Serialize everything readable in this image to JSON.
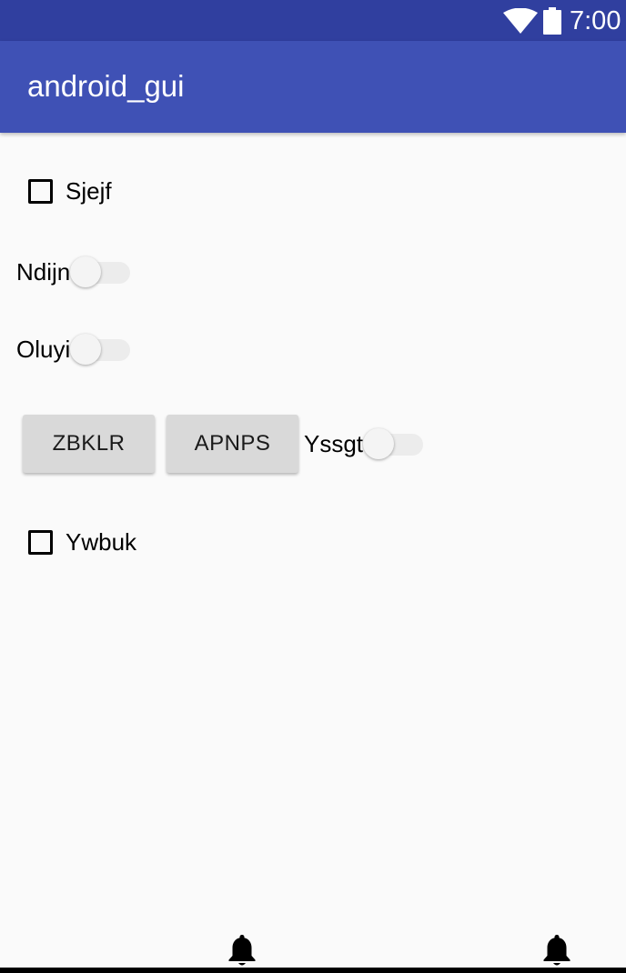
{
  "status_bar": {
    "time": "7:00",
    "icons": [
      "wifi-icon",
      "battery-icon"
    ],
    "background": "#303f9f"
  },
  "app_bar": {
    "title": "android_gui",
    "background": "#3f51b5"
  },
  "controls": {
    "checkbox_1": {
      "label": "Sjejf",
      "checked": false
    },
    "switch_1": {
      "label": "Ndijn",
      "on": false
    },
    "switch_2": {
      "label": "Oluyi",
      "on": false
    },
    "button_1": {
      "label": "ZBKLR"
    },
    "button_2": {
      "label": "APNPS"
    },
    "switch_3": {
      "label": "Yssgt",
      "on": false
    },
    "checkbox_2": {
      "label": "Ywbuk",
      "checked": false
    }
  },
  "bottom_icons": [
    "bell-icon",
    "bell-icon"
  ]
}
